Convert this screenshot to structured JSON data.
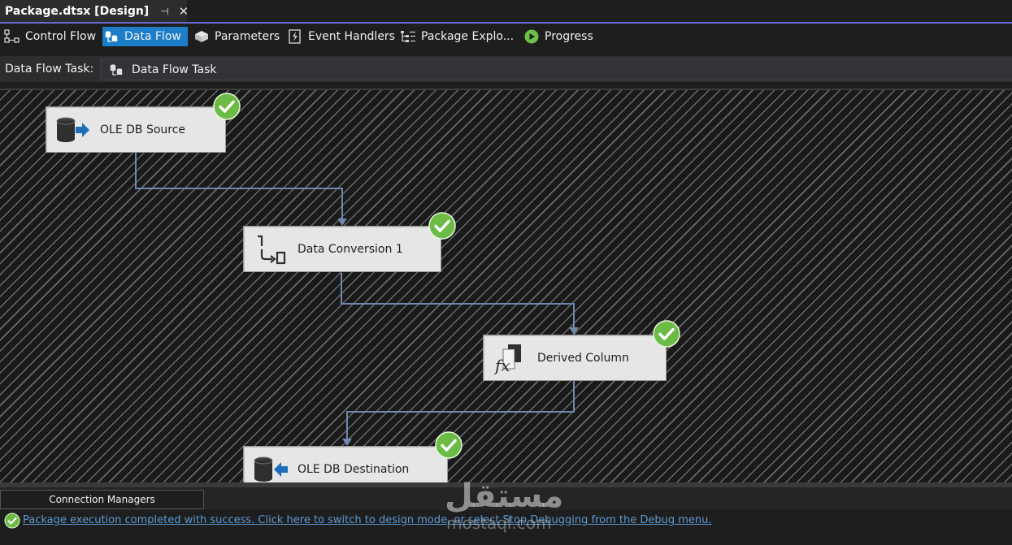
{
  "document_tab": {
    "title": "Package.dtsx [Design]",
    "pin_glyph": "⊣",
    "close_glyph": "✕"
  },
  "designer_tabs": [
    {
      "label": "Control Flow",
      "icon": "control-flow-icon",
      "active": false
    },
    {
      "label": "Data Flow",
      "icon": "data-flow-icon",
      "active": true
    },
    {
      "label": "Parameters",
      "icon": "parameters-icon",
      "active": false
    },
    {
      "label": "Event Handlers",
      "icon": "event-handlers-icon",
      "active": false
    },
    {
      "label": "Package Explo...",
      "icon": "package-explorer-icon",
      "active": false
    },
    {
      "label": "Progress",
      "icon": "progress-icon",
      "active": false
    }
  ],
  "task_bar": {
    "label": "Data Flow Task:",
    "selected_task": "Data Flow Task"
  },
  "components": [
    {
      "label": "OLE DB Source",
      "icon": "ole-db-source-icon",
      "status": "success"
    },
    {
      "label": "Data Conversion 1",
      "icon": "data-conversion-icon",
      "status": "success"
    },
    {
      "label": "Derived Column",
      "icon": "derived-column-icon",
      "status": "success"
    },
    {
      "label": "OLE DB Destination",
      "icon": "ole-db-destination-icon",
      "status": "success"
    }
  ],
  "connection_managers": {
    "tab_label": "Connection Managers"
  },
  "status": {
    "message": "Package execution completed with success. Click here to switch to design mode, or select Stop Debugging from the Debug menu."
  },
  "watermark": {
    "arabic": "مستقل",
    "latin": "mostaql.com"
  },
  "colors": {
    "accent": "#1c7ec9",
    "success": "#5cb85c",
    "connector": "#6e88b0",
    "link": "#5b9bd5",
    "tab_underline": "#6b69d6"
  }
}
